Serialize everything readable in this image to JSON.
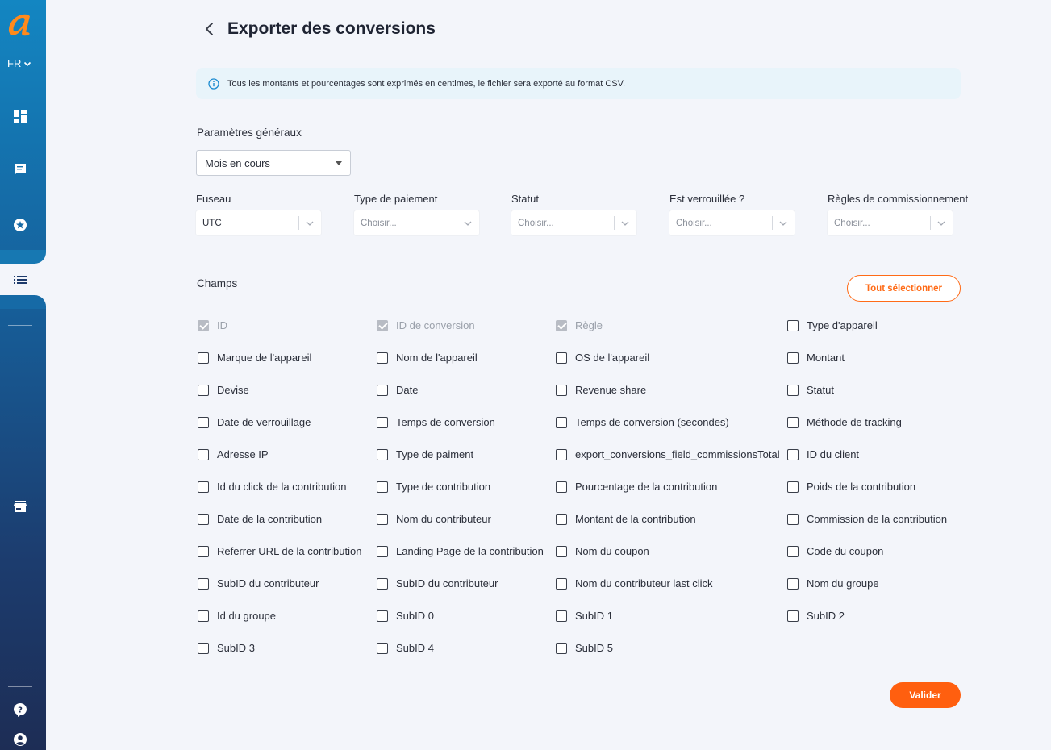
{
  "app": {
    "language": "FR"
  },
  "header": {
    "title": "Exporter des conversions"
  },
  "banner": {
    "text": "Tous les montants et pourcentages sont exprimés en centimes, le fichier sera exporté au format CSV."
  },
  "general": {
    "label": "Paramètres généraux",
    "period_value": "Mois en cours"
  },
  "filters": [
    {
      "label": "Fuseau",
      "value": "UTC",
      "placeholder": false
    },
    {
      "label": "Type de paiement",
      "value": "Choisir...",
      "placeholder": true
    },
    {
      "label": "Statut",
      "value": "Choisir...",
      "placeholder": true
    },
    {
      "label": "Est verrouillée ?",
      "value": "Choisir...",
      "placeholder": true
    },
    {
      "label": "Règles de commissionnement",
      "value": "Choisir...",
      "placeholder": true
    }
  ],
  "fields": {
    "label": "Champs",
    "select_all_label": "Tout sélectionner",
    "items": [
      {
        "label": "ID",
        "checked": true,
        "disabled": true
      },
      {
        "label": "ID de conversion",
        "checked": true,
        "disabled": true
      },
      {
        "label": "Règle",
        "checked": true,
        "disabled": true
      },
      {
        "label": "Type d'appareil",
        "checked": false,
        "disabled": false
      },
      {
        "label": "Marque de l'appareil",
        "checked": false,
        "disabled": false
      },
      {
        "label": "Nom de l'appareil",
        "checked": false,
        "disabled": false
      },
      {
        "label": "OS de l'appareil",
        "checked": false,
        "disabled": false
      },
      {
        "label": "Montant",
        "checked": false,
        "disabled": false
      },
      {
        "label": "Devise",
        "checked": false,
        "disabled": false
      },
      {
        "label": "Date",
        "checked": false,
        "disabled": false
      },
      {
        "label": "Revenue share",
        "checked": false,
        "disabled": false
      },
      {
        "label": "Statut",
        "checked": false,
        "disabled": false
      },
      {
        "label": "Date de verrouillage",
        "checked": false,
        "disabled": false
      },
      {
        "label": "Temps de conversion",
        "checked": false,
        "disabled": false
      },
      {
        "label": "Temps de conversion (secondes)",
        "checked": false,
        "disabled": false
      },
      {
        "label": "Méthode de tracking",
        "checked": false,
        "disabled": false
      },
      {
        "label": "Adresse IP",
        "checked": false,
        "disabled": false
      },
      {
        "label": "Type de paiment",
        "checked": false,
        "disabled": false
      },
      {
        "label": "export_conversions_field_commissionsTotal",
        "checked": false,
        "disabled": false
      },
      {
        "label": "ID du client",
        "checked": false,
        "disabled": false
      },
      {
        "label": "Id du click de la contribution",
        "checked": false,
        "disabled": false
      },
      {
        "label": "Type de contribution",
        "checked": false,
        "disabled": false
      },
      {
        "label": "Pourcentage de la contribution",
        "checked": false,
        "disabled": false
      },
      {
        "label": "Poids de la contribution",
        "checked": false,
        "disabled": false
      },
      {
        "label": "Date de la contribution",
        "checked": false,
        "disabled": false
      },
      {
        "label": "Nom du contributeur",
        "checked": false,
        "disabled": false
      },
      {
        "label": "Montant de la contribution",
        "checked": false,
        "disabled": false
      },
      {
        "label": "Commission de la contribution",
        "checked": false,
        "disabled": false
      },
      {
        "label": "Referrer URL de la contribution",
        "checked": false,
        "disabled": false
      },
      {
        "label": "Landing Page de la contribution",
        "checked": false,
        "disabled": false
      },
      {
        "label": "Nom du coupon",
        "checked": false,
        "disabled": false
      },
      {
        "label": "Code du coupon",
        "checked": false,
        "disabled": false
      },
      {
        "label": "SubID du contributeur",
        "checked": false,
        "disabled": false
      },
      {
        "label": "SubID du contributeur",
        "checked": false,
        "disabled": false
      },
      {
        "label": "Nom du contributeur last click",
        "checked": false,
        "disabled": false
      },
      {
        "label": "Nom du groupe",
        "checked": false,
        "disabled": false
      },
      {
        "label": "Id du groupe",
        "checked": false,
        "disabled": false
      },
      {
        "label": "SubID 0",
        "checked": false,
        "disabled": false
      },
      {
        "label": "SubID 1",
        "checked": false,
        "disabled": false
      },
      {
        "label": "SubID 2",
        "checked": false,
        "disabled": false
      },
      {
        "label": "SubID 3",
        "checked": false,
        "disabled": false
      },
      {
        "label": "SubID 4",
        "checked": false,
        "disabled": false
      },
      {
        "label": "SubID 5",
        "checked": false,
        "disabled": false
      }
    ]
  },
  "actions": {
    "validate_label": "Valider"
  },
  "colors": {
    "accent": "#ff5f0f",
    "sidebar_top": "#1386c2",
    "sidebar_bottom": "#1d2d55",
    "banner_bg": "#e8f4fa"
  }
}
